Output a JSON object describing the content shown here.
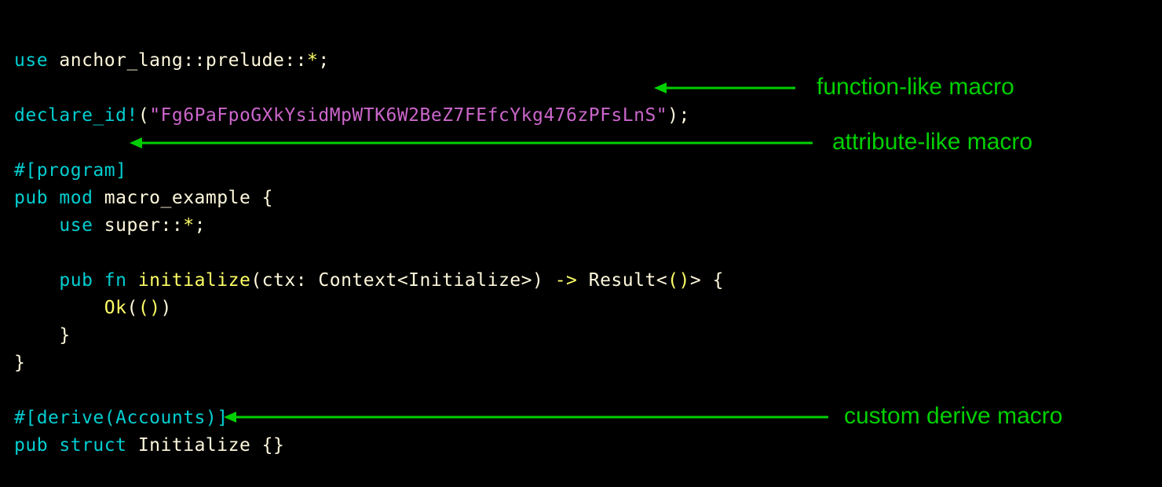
{
  "code": {
    "l1_use": "use",
    "l1_path": " anchor_lang::prelude::",
    "l1_star": "*",
    "l1_semi": ";",
    "l3_macro": "declare_id!",
    "l3_open": "(",
    "l3_str": "\"Fg6PaFpoGXkYsidMpWTK6W2BeZ7FEfcYkg476zPFsLnS\"",
    "l3_close": ");",
    "l5_attr": "#[program]",
    "l6_pub": "pub ",
    "l6_mod": "mod ",
    "l6_name": "macro_example",
    "l6_brace": " {",
    "l7_indent": "    ",
    "l7_use": "use",
    "l7_path": " super::",
    "l7_star": "*",
    "l7_semi": ";",
    "l9_indent": "    ",
    "l9_pub": "pub ",
    "l9_fn": "fn ",
    "l9_name": "initialize",
    "l9_sig1": "(ctx: Context<Initialize>) ",
    "l9_arrow": "->",
    "l9_sig2": " Result<",
    "l9_unit": "()",
    "l9_sig3": "> {",
    "l10_indent": "        ",
    "l10_ok": "Ok",
    "l10_paren1": "(",
    "l10_unit": "()",
    "l10_paren2": ")",
    "l11_indent": "    ",
    "l11_brace": "}",
    "l12_brace": "}",
    "l14_attr": "#[derive(Accounts)]",
    "l15_pub": "pub ",
    "l15_struct": "struct ",
    "l15_name": "Initialize",
    "l15_body": " {}"
  },
  "annotations": {
    "function_like": "function-like macro",
    "attribute_like": "attribute-like macro",
    "custom_derive": "custom derive macro"
  },
  "colors": {
    "annotation": "#00D000",
    "keyword": "#00CED1",
    "identifier": "#FFF8DC",
    "string": "#CC66CC",
    "operator": "#FFFF66"
  }
}
